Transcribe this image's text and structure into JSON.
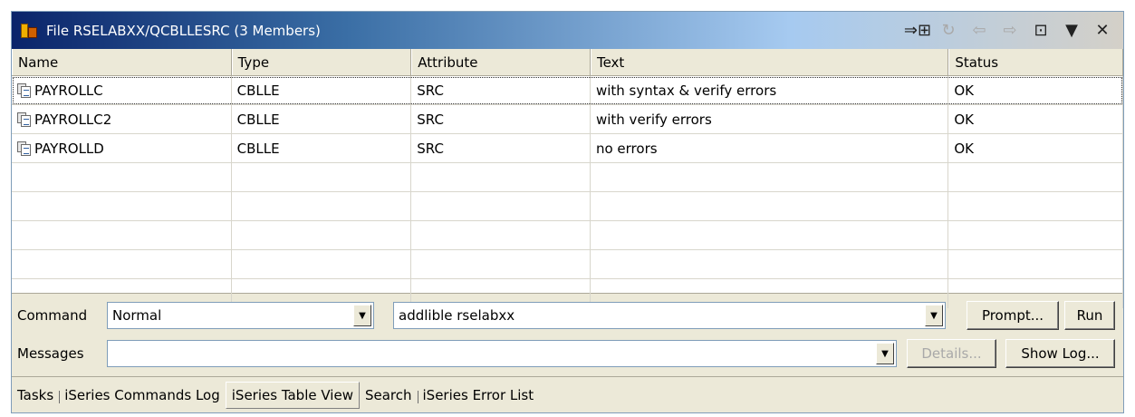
{
  "window": {
    "title": "File RSELABXX/QCBLLESRC (3 Members)"
  },
  "table": {
    "columns": [
      "Name",
      "Type",
      "Attribute",
      "Text",
      "Status"
    ],
    "rows": [
      {
        "name": "PAYROLLC",
        "type": "CBLLE",
        "attribute": "SRC",
        "text": "with syntax & verify errors",
        "status": "OK"
      },
      {
        "name": "PAYROLLC2",
        "type": "CBLLE",
        "attribute": "SRC",
        "text": "with verify errors",
        "status": "OK"
      },
      {
        "name": "PAYROLLD",
        "type": "CBLLE",
        "attribute": "SRC",
        "text": "no errors",
        "status": "OK"
      }
    ]
  },
  "command": {
    "label": "Command",
    "mode": "Normal",
    "value": "addlible rselabxx",
    "prompt_button": "Prompt...",
    "run_button": "Run"
  },
  "messages": {
    "label": "Messages",
    "value": "",
    "details_button": "Details...",
    "showlog_button": "Show Log..."
  },
  "tabs": [
    "Tasks",
    "iSeries Commands Log",
    "iSeries Table View",
    "Search",
    "iSeries Error List"
  ]
}
